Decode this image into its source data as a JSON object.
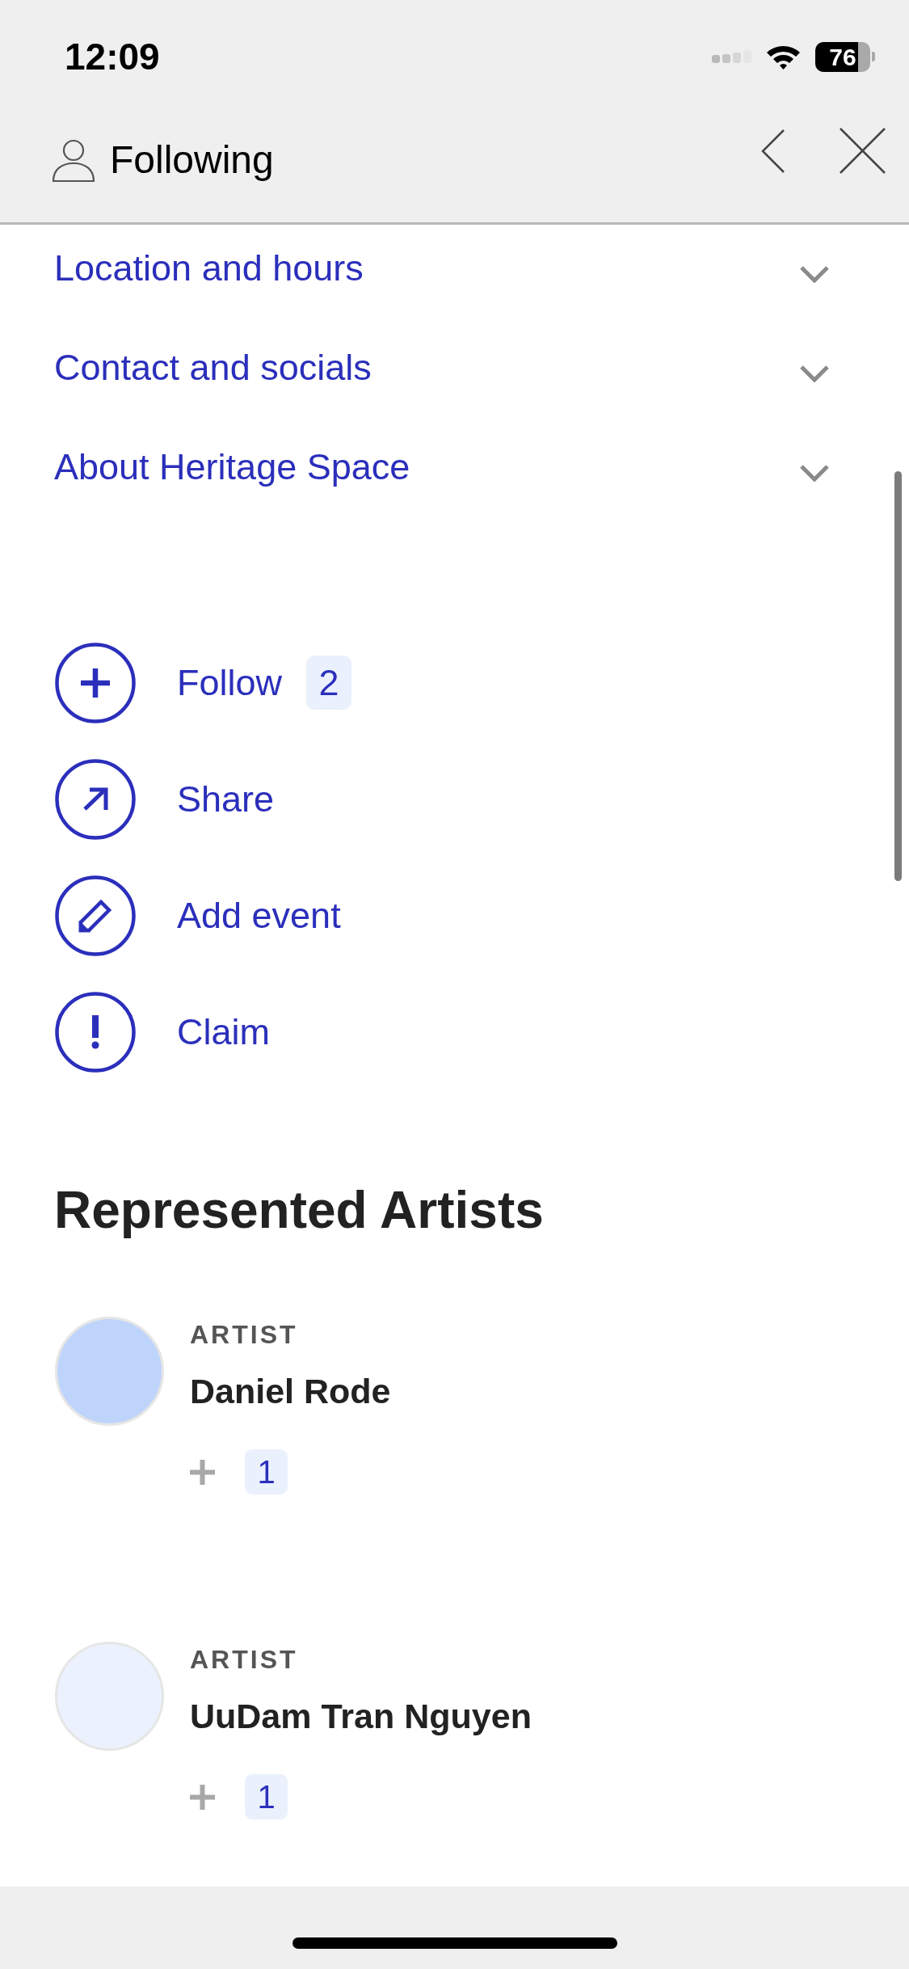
{
  "status_bar": {
    "time": "12:09",
    "battery": "76"
  },
  "header": {
    "title": "Following"
  },
  "sections": [
    {
      "label": "Location and hours",
      "expanded": false
    },
    {
      "label": "Contact and socials",
      "expanded": false
    },
    {
      "label": "About Heritage Space",
      "expanded": false
    }
  ],
  "actions": [
    {
      "kind": "follow",
      "label": "Follow",
      "count": "2"
    },
    {
      "kind": "share",
      "label": "Share"
    },
    {
      "kind": "add_event",
      "label": "Add event"
    },
    {
      "kind": "claim",
      "label": "Claim"
    }
  ],
  "represented_artists": {
    "title": "Represented Artists",
    "artists": [
      {
        "role": "ARTIST",
        "name": "Daniel Rode",
        "count": "1",
        "color": "#bed4fb"
      },
      {
        "role": "ARTIST",
        "name": "UuDam Tran Nguyen",
        "count": "1",
        "color": "#ebf2fe"
      }
    ]
  }
}
